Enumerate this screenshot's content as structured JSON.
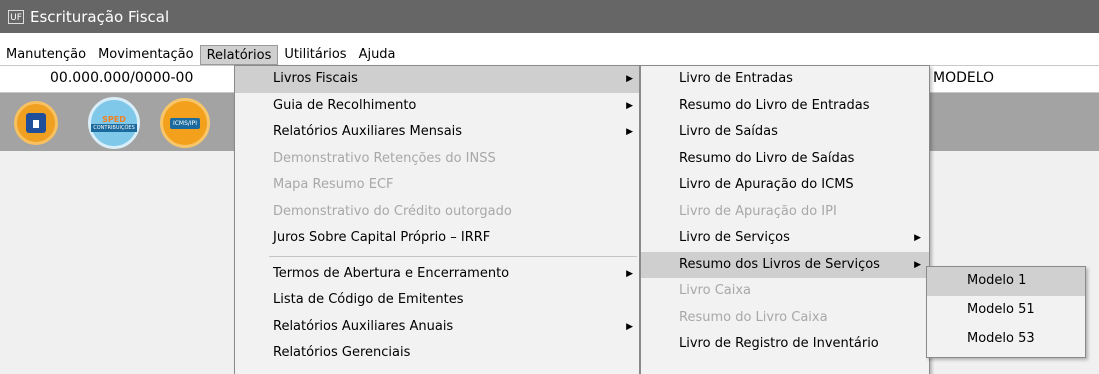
{
  "window": {
    "title": "Escrituração Fiscal",
    "app_icon": "UF"
  },
  "menubar": [
    {
      "label": "Manutenção"
    },
    {
      "label": "Movimentação"
    },
    {
      "label": "Relatórios"
    },
    {
      "label": "Utilitários"
    },
    {
      "label": "Ajuda"
    }
  ],
  "info": {
    "cnpj": "00.000.000/0000-00",
    "modelo": "MODELO"
  },
  "toolbar": {
    "sped_top": "SPED",
    "sped_bottom": "CONTRIBUIÇÕES",
    "icms": "ICMS/IPI"
  },
  "relatorios_menu": [
    {
      "label": "Livros Fiscais"
    },
    {
      "label": "Guia de Recolhimento"
    },
    {
      "label": "Relatórios Auxiliares Mensais"
    },
    {
      "label": "Demonstrativo Retenções do INSS"
    },
    {
      "label": "Mapa Resumo ECF"
    },
    {
      "label": "Demonstrativo do Crédito outorgado"
    },
    {
      "label": "Juros Sobre Capital Próprio – IRRF"
    },
    {
      "label": "Termos de Abertura e Encerramento"
    },
    {
      "label": "Lista de Código de Emitentes"
    },
    {
      "label": "Relatórios Auxiliares Anuais"
    },
    {
      "label": "Relatórios Gerenciais"
    }
  ],
  "livros_menu": [
    {
      "label": "Livro de Entradas"
    },
    {
      "label": "Resumo do Livro de Entradas"
    },
    {
      "label": "Livro de Saídas"
    },
    {
      "label": "Resumo do Livro de Saídas"
    },
    {
      "label": "Livro de Apuração do ICMS"
    },
    {
      "label": "Livro de Apuração do IPI"
    },
    {
      "label": "Livro de Serviços"
    },
    {
      "label": "Resumo dos Livros de Serviços"
    },
    {
      "label": "Livro Caixa"
    },
    {
      "label": "Resumo do Livro Caixa"
    },
    {
      "label": "Livro de Registro de Inventário"
    }
  ],
  "resumo_menu": [
    {
      "label": "Modelo 1"
    },
    {
      "label": "Modelo 51"
    },
    {
      "label": "Modelo 53"
    }
  ],
  "arrow_glyph": "▶"
}
